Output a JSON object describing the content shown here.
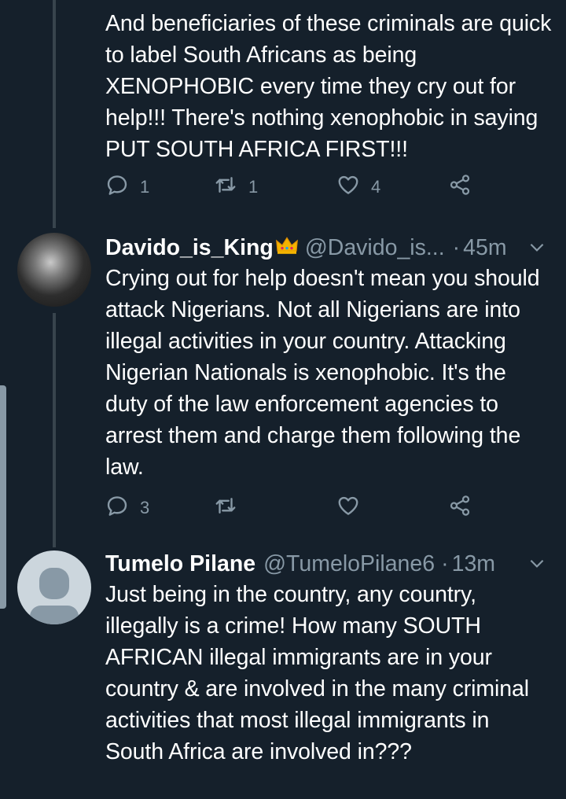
{
  "tweets": [
    {
      "text": "And beneficiaries of these criminals are quick to label South Africans as being XENOPHOBIC every time they cry out for help!!! There's nothing xenophobic in saying PUT SOUTH AFRICA FIRST!!!",
      "actions": {
        "reply": "1",
        "retweet": "1",
        "like": "4"
      }
    },
    {
      "name": "Davido_is_King",
      "handle": "@Davido_is...",
      "dot": "·",
      "time": "45m",
      "text": "Crying out for help doesn't mean you should attack Nigerians. Not all Nigerians are into illegal activities in your country. Attacking Nigerian Nationals is xenophobic.  It's the duty of the law enforcement agencies to arrest them and charge them following the law.",
      "actions": {
        "reply": "3",
        "retweet": "",
        "like": ""
      }
    },
    {
      "name": "Tumelo Pilane",
      "handle": "@TumeloPilane6",
      "dot": "·",
      "time": "13m",
      "text": "Just being in the country, any country, illegally is a crime! How many SOUTH AFRICAN illegal immigrants are in your country & are involved in the many criminal activities that most illegal immigrants in South Africa are involved in???"
    }
  ],
  "icons": {
    "reply": "reply-icon",
    "retweet": "retweet-icon",
    "like": "like-icon",
    "share": "share-icon",
    "more": "chevron-down-icon",
    "badge": "crown-icon"
  },
  "colors": {
    "background": "#15202b",
    "primary_text": "#ffffff",
    "secondary_text": "#8899a6",
    "thread_line": "#38444d"
  }
}
